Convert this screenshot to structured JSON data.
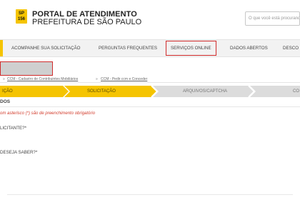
{
  "header": {
    "logo_line1": "SP",
    "logo_line2": "156",
    "brand_title": "PORTAL DE ATENDIMENTO",
    "brand_subtitle": "PREFEITURA DE SÃO PAULO",
    "search_placeholder": "O que você está procurando?"
  },
  "nav": {
    "items": [
      {
        "label": "ACOMPANHE SUA SOLICITAÇÃO"
      },
      {
        "label": "PERGUNTAS FREQUENTES"
      },
      {
        "label": "SERVIÇOS ONLINE"
      },
      {
        "label": "DADOS ABERTOS"
      },
      {
        "label": "DESCO"
      }
    ]
  },
  "breadcrumb": {
    "items": [
      {
        "label": "» "
      },
      {
        "label": "CCM - Cadastro de Contribuintes Mobiliários"
      },
      {
        "label": " » "
      },
      {
        "label": "CCM - Pedir ccm e Conceder"
      }
    ]
  },
  "steps": [
    {
      "label": "IÇÃO",
      "state": "done"
    },
    {
      "label": "SOLICITAÇÃO",
      "state": "current"
    },
    {
      "label": "ARQUIVOS/CAPTCHA",
      "state": "pending"
    },
    {
      "label": "CO",
      "state": "pending"
    }
  ],
  "form": {
    "section_title": "DOS",
    "required_note": "om asterisco (*) são de preenchimento obrigatório",
    "fields": [
      {
        "label": "LICITANTE?*"
      },
      {
        "label": "DESEJA SABER?*"
      }
    ]
  },
  "colors": {
    "accent_yellow": "#f5c400",
    "highlight_red": "#d12b2b",
    "required_red": "#d23a2a",
    "step_pending": "#dcdcdc"
  }
}
